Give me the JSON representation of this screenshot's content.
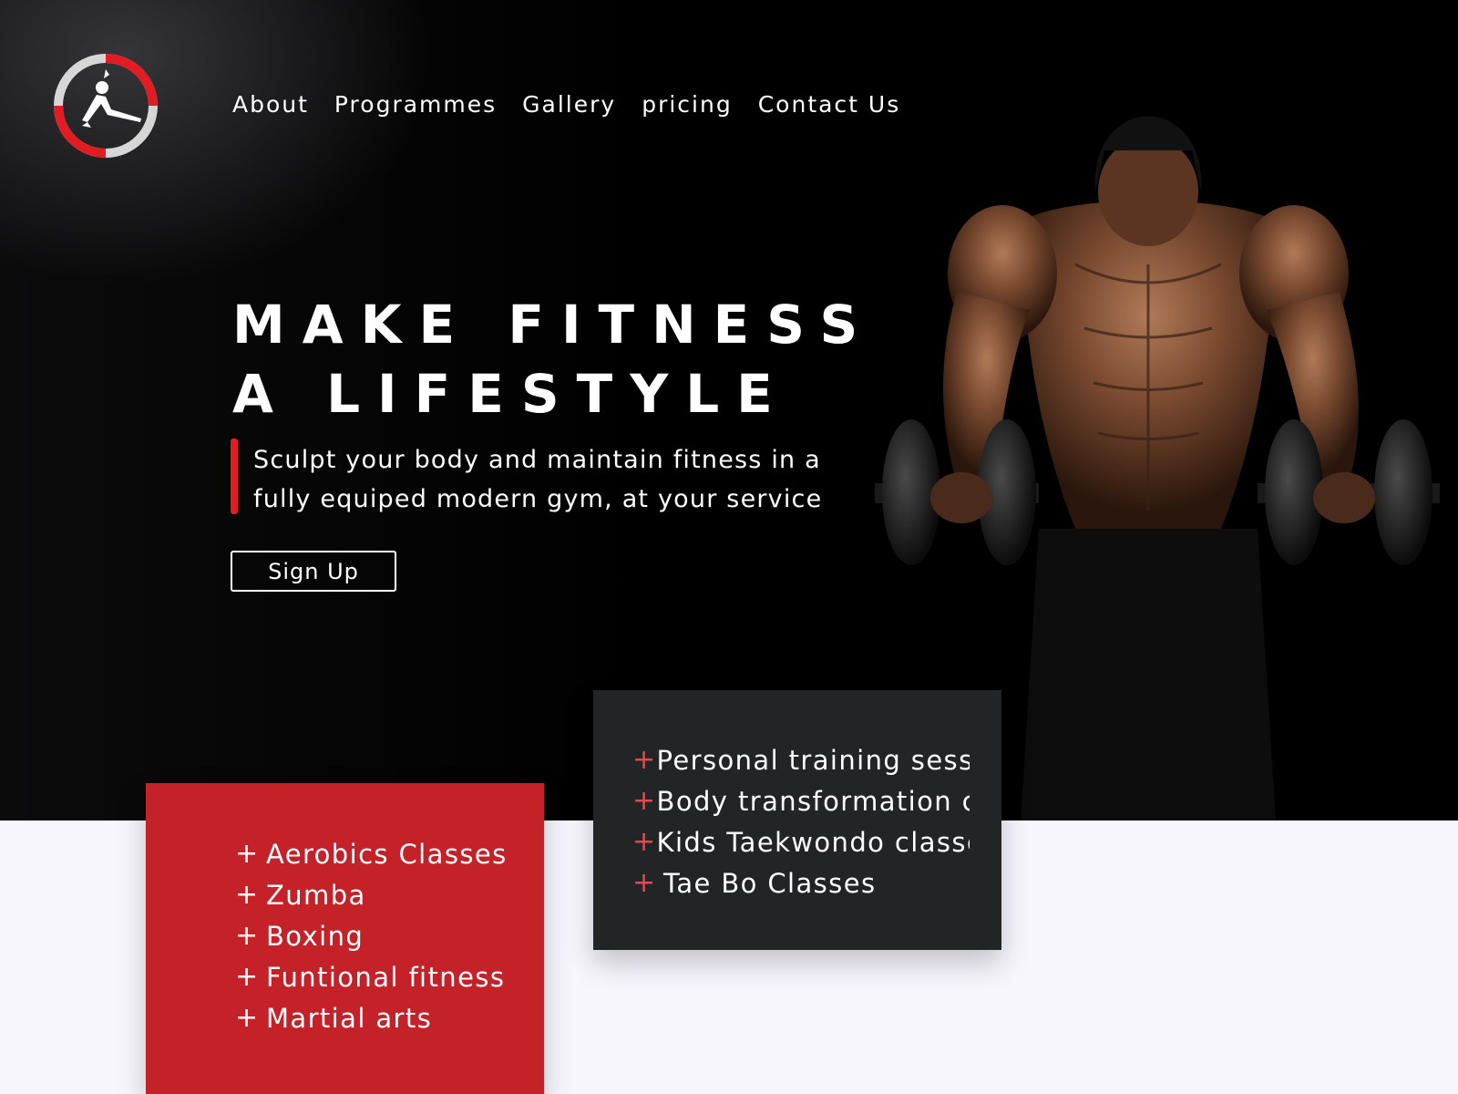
{
  "brand": {
    "logo_icon": "dancer-logo-icon",
    "accent": "#e31b23"
  },
  "nav": {
    "items": [
      {
        "label": "About"
      },
      {
        "label": "Programmes"
      },
      {
        "label": "Gallery"
      },
      {
        "label": "pricing"
      },
      {
        "label": "Contact Us"
      }
    ]
  },
  "hero": {
    "headline_line1": "MAKE FITNESS",
    "headline_line2": "A LIFESTYLE",
    "tagline_line1": "Sculpt your body and maintain fitness in a",
    "tagline_line2": "fully equiped modern gym, at your service",
    "cta_label": "Sign Up",
    "image": "bodybuilder-with-dumbbells"
  },
  "programmes_primary": {
    "color": "#c42128",
    "items": [
      {
        "marker": "+",
        "label": "Aerobics Classes"
      },
      {
        "marker": "+",
        "label": "Zumba"
      },
      {
        "marker": "+",
        "label": "Boxing"
      },
      {
        "marker": "+",
        "label": "Funtional fitness"
      },
      {
        "marker": "+",
        "label": "Martial arts"
      }
    ]
  },
  "programmes_secondary": {
    "color": "#222426",
    "items": [
      {
        "marker": "+",
        "label": "Personal training sessio"
      },
      {
        "marker": "+",
        "label": "Body transformation ch"
      },
      {
        "marker": "+",
        "label": "Kids Taekwondo classe"
      },
      {
        "marker": "+",
        "label": "Tae Bo Classes"
      }
    ]
  }
}
